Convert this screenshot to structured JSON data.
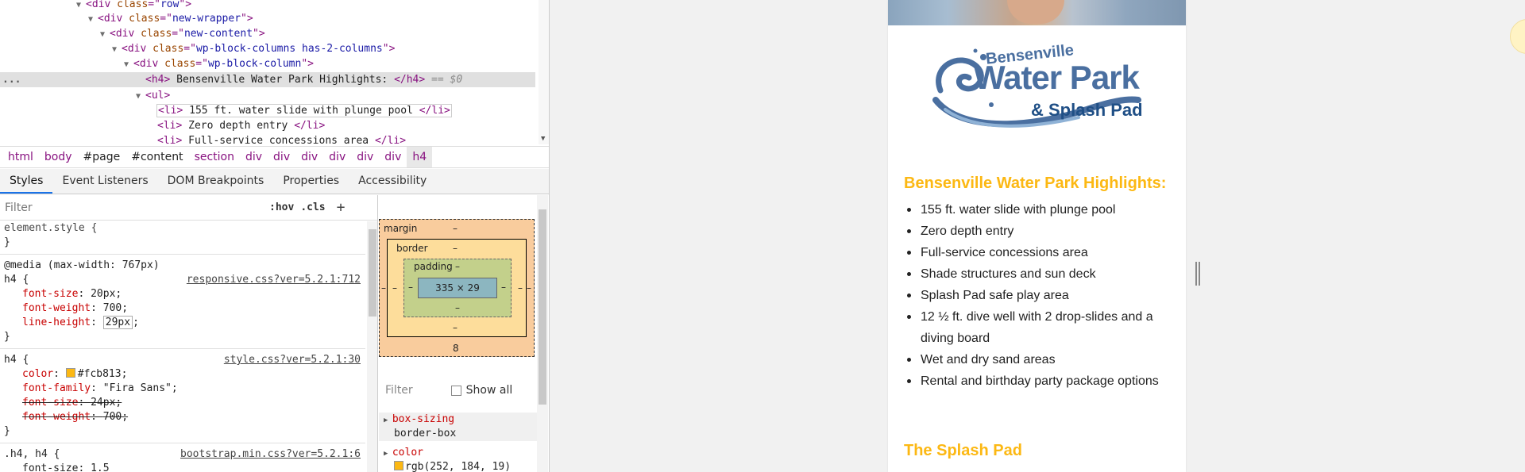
{
  "dom_tree": {
    "lines": [
      {
        "tag": "div",
        "attr": "class",
        "val": "row"
      },
      {
        "tag": "div",
        "attr": "class",
        "val": "new-wrapper"
      },
      {
        "tag": "div",
        "attr": "class",
        "val": "new-content"
      },
      {
        "tag": "div",
        "attr": "class",
        "val": "wp-block-columns has-2-columns"
      },
      {
        "tag": "div",
        "attr": "class",
        "val": "wp-block-column"
      }
    ],
    "selected": {
      "open": "<h4>",
      "text": " Bensenville Water Park Highlights: ",
      "close": "</h4>",
      "eq": " == $0"
    },
    "ul": "<ul>",
    "li1": {
      "open": "<li>",
      "text": " 155 ft. water slide with plunge pool ",
      "close": "</li>"
    },
    "li2": {
      "open": "<li>",
      "text": " Zero depth entry ",
      "close": "</li>"
    },
    "li3": {
      "open": "<li>",
      "text": " Full-service concessions area ",
      "close": "</li>"
    },
    "ellipsis": "..."
  },
  "breadcrumbs": [
    "html",
    "body",
    "#page",
    "#content",
    "section",
    "div",
    "div",
    "div",
    "div",
    "div",
    "div",
    "h4"
  ],
  "tabs": [
    "Styles",
    "Event Listeners",
    "DOM Breakpoints",
    "Properties",
    "Accessibility"
  ],
  "styles": {
    "filter_placeholder": "Filter",
    "hov": ":hov",
    "cls": ".cls",
    "plus": "+",
    "element_style": "element.style {",
    "close_brace": "}",
    "media": "@media (max-width: 767px)",
    "rule1": {
      "selector": "h4 {",
      "source": "responsive.css?ver=5.2.1:712",
      "props": [
        {
          "name": "font-size",
          "value": "20px"
        },
        {
          "name": "font-weight",
          "value": "700"
        },
        {
          "name": "line-height",
          "value": "29px"
        }
      ]
    },
    "rule2": {
      "selector": "h4 {",
      "source": "style.css?ver=5.2.1:30",
      "color_name": "color",
      "color_value": "#fcb813",
      "font_family_name": "font-family",
      "font_family_value": "\"Fira Sans\"",
      "struck": [
        {
          "name": "font-size",
          "value": "24px"
        },
        {
          "name": "font-weight",
          "value": "700"
        }
      ]
    },
    "rule3": {
      "selector": ".h4, h4 {",
      "source": "bootstrap.min.css?ver=5.2.1:6",
      "partial": "font-size: 1.5"
    }
  },
  "box_model": {
    "margin_label": "margin",
    "border_label": "border",
    "padding_label": "padding",
    "content": "335 × 29",
    "dash": "–",
    "margin_bottom": "8"
  },
  "computed": {
    "filter_placeholder": "Filter",
    "show_all": "Show all",
    "props": [
      {
        "name": "box-sizing",
        "value": "border-box"
      },
      {
        "name": "color",
        "value": "rgb(252, 184, 19)"
      }
    ]
  },
  "page": {
    "logo_line1": "Bensenville",
    "logo_line2": "Water Park",
    "logo_line3": "& Splash Pad",
    "heading": "Bensenville Water Park Highlights:",
    "highlights": [
      "155 ft. water slide with plunge pool",
      "Zero depth entry",
      "Full-service concessions area",
      "Shade structures and sun deck",
      "Splash Pad safe play area",
      "12 ½ ft. dive well with 2 drop-slides and a diving board",
      "Wet and dry sand areas",
      "Rental and birthday party package options"
    ],
    "heading2": "The Splash Pad"
  },
  "colors": {
    "heading": "#fcb813",
    "logo_light": "#4a6fa0",
    "logo_dark": "#1f4f86",
    "tab_active": "#1a73e8"
  }
}
